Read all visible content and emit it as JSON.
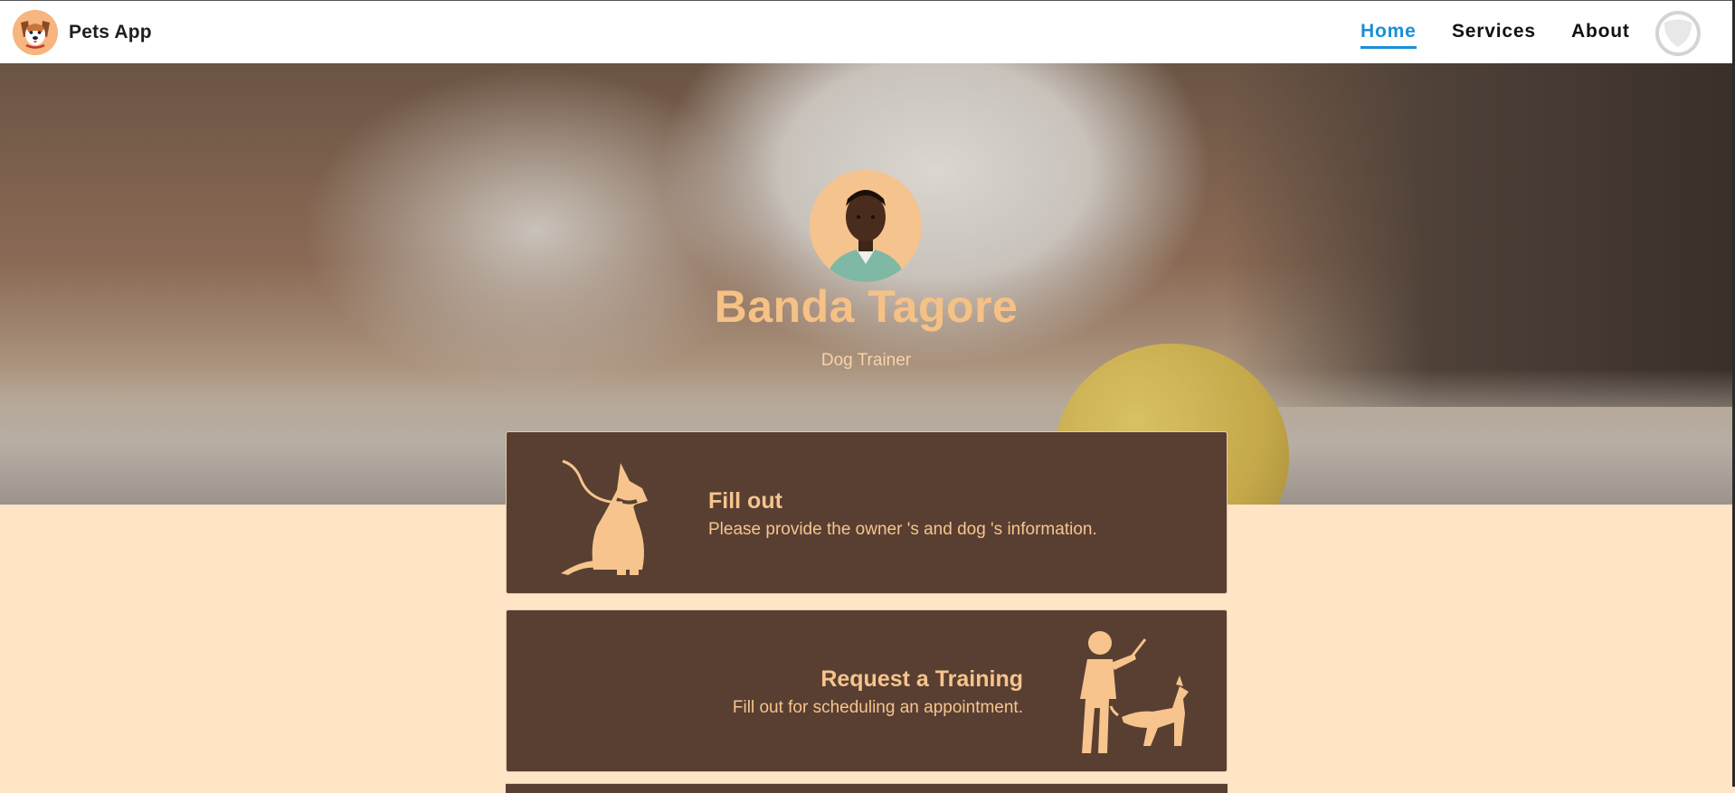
{
  "header": {
    "brand": "Pets App",
    "nav": [
      {
        "label": "Home",
        "active": true
      },
      {
        "label": "Services",
        "active": false
      },
      {
        "label": "About",
        "active": false
      }
    ]
  },
  "profile": {
    "name": "Banda Tagore",
    "role": "Dog Trainer"
  },
  "cards": [
    {
      "title": "Fill out",
      "description": "Please provide the owner 's and dog 's information.",
      "icon": "sitting-dog-leash-icon"
    },
    {
      "title": "Request a Training",
      "description": "Fill out for scheduling an appointment.",
      "icon": "trainer-with-dog-icon"
    }
  ],
  "colors": {
    "accent": "#1a8fd8",
    "card_bg": "#583f32",
    "card_text": "#f7c48d",
    "page_bg": "#ffe4c6"
  }
}
